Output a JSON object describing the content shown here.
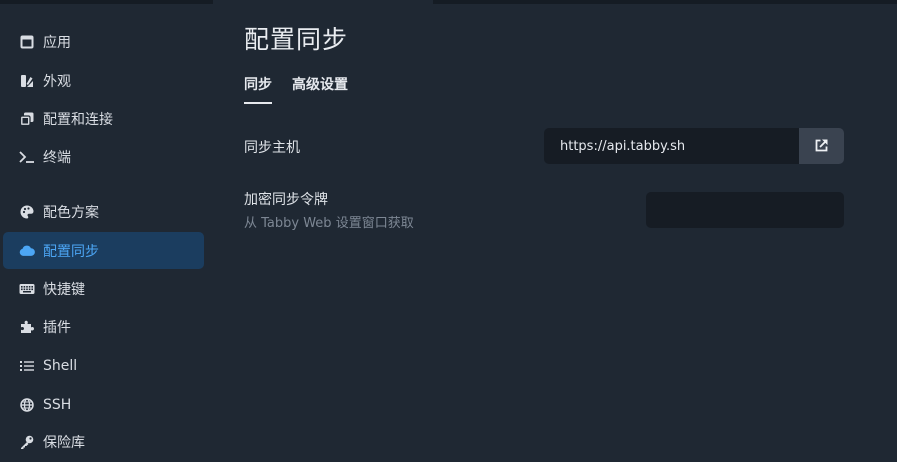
{
  "sidebar": {
    "items": [
      {
        "label": "应用",
        "icon": "window-icon"
      },
      {
        "label": "外观",
        "icon": "paint-brush-icon"
      },
      {
        "label": "配置和连接",
        "icon": "copy-icon"
      },
      {
        "label": "终端",
        "icon": "terminal-icon"
      },
      {
        "label": "配色方案",
        "icon": "palette-icon"
      },
      {
        "label": "配置同步",
        "icon": "cloud-icon",
        "active": true
      },
      {
        "label": "快捷键",
        "icon": "keyboard-icon"
      },
      {
        "label": "插件",
        "icon": "puzzle-icon"
      },
      {
        "label": "Shell",
        "icon": "list-icon"
      },
      {
        "label": "SSH",
        "icon": "globe-icon"
      },
      {
        "label": "保险库",
        "icon": "key-icon"
      }
    ]
  },
  "main": {
    "title": "配置同步",
    "tabs": [
      {
        "label": "同步",
        "active": true
      },
      {
        "label": "高级设置"
      }
    ],
    "host": {
      "label": "同步主机",
      "value": "https://api.tabby.sh"
    },
    "token": {
      "label": "加密同步令牌",
      "hint": "从 Tabby Web 设置窗口获取",
      "value": ""
    }
  },
  "colors": {
    "background": "#1f2833",
    "active_item_bg": "#1b3d5f",
    "active_item_text": "#4ca6f5",
    "input_bg": "#161c24",
    "button_bg": "#3a4350"
  }
}
